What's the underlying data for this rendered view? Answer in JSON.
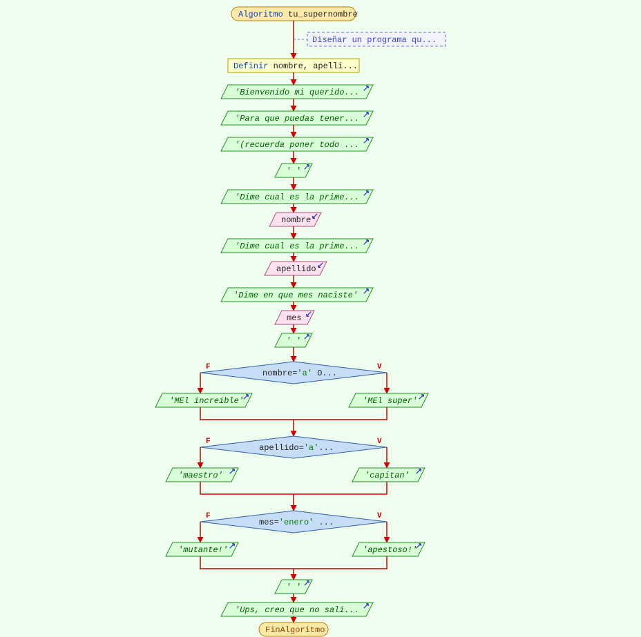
{
  "title_keyword": "Algoritmo",
  "title_name": "tu_supernombre",
  "comment": "Diseñar un programa qu...",
  "definir_keyword": "Definir",
  "definir_rest": " nombre, apelli...",
  "out1": "'Bienvenido mi querido...",
  "out2": "'Para que puedas tener...",
  "out3": "'(recuerda poner todo ...",
  "out4": "' '",
  "out5": "'Dime cual es la prime...",
  "in1": "nombre",
  "out6": "'Dime cual es la prime...",
  "in2": "apellido",
  "out7": "'Dime en que mes naciste'",
  "in3": "mes",
  "out8": "' '",
  "d1_a": "nombre",
  "d1_eq": "=",
  "d1_b": "'a'",
  "d1_c": " O...",
  "d1_false_out": "'MEl increible'",
  "d1_true_out": "'MEl super'",
  "d2_a": "apellido",
  "d2_eq": "=",
  "d2_b": "'a'",
  "d2_c": "...",
  "d2_false_out": "'maestro'",
  "d2_true_out": "'capitan'",
  "d3_a": "mes",
  "d3_eq": "=",
  "d3_b": "'enero'",
  "d3_c": " ...",
  "d3_false_out": "'mutante!'",
  "d3_true_out": "'apestoso!'",
  "out_final1": "' '",
  "out_final2": "'Ups, creo que no sali...",
  "end": "FinAlgoritmo",
  "label_f": "F",
  "label_v": "V"
}
